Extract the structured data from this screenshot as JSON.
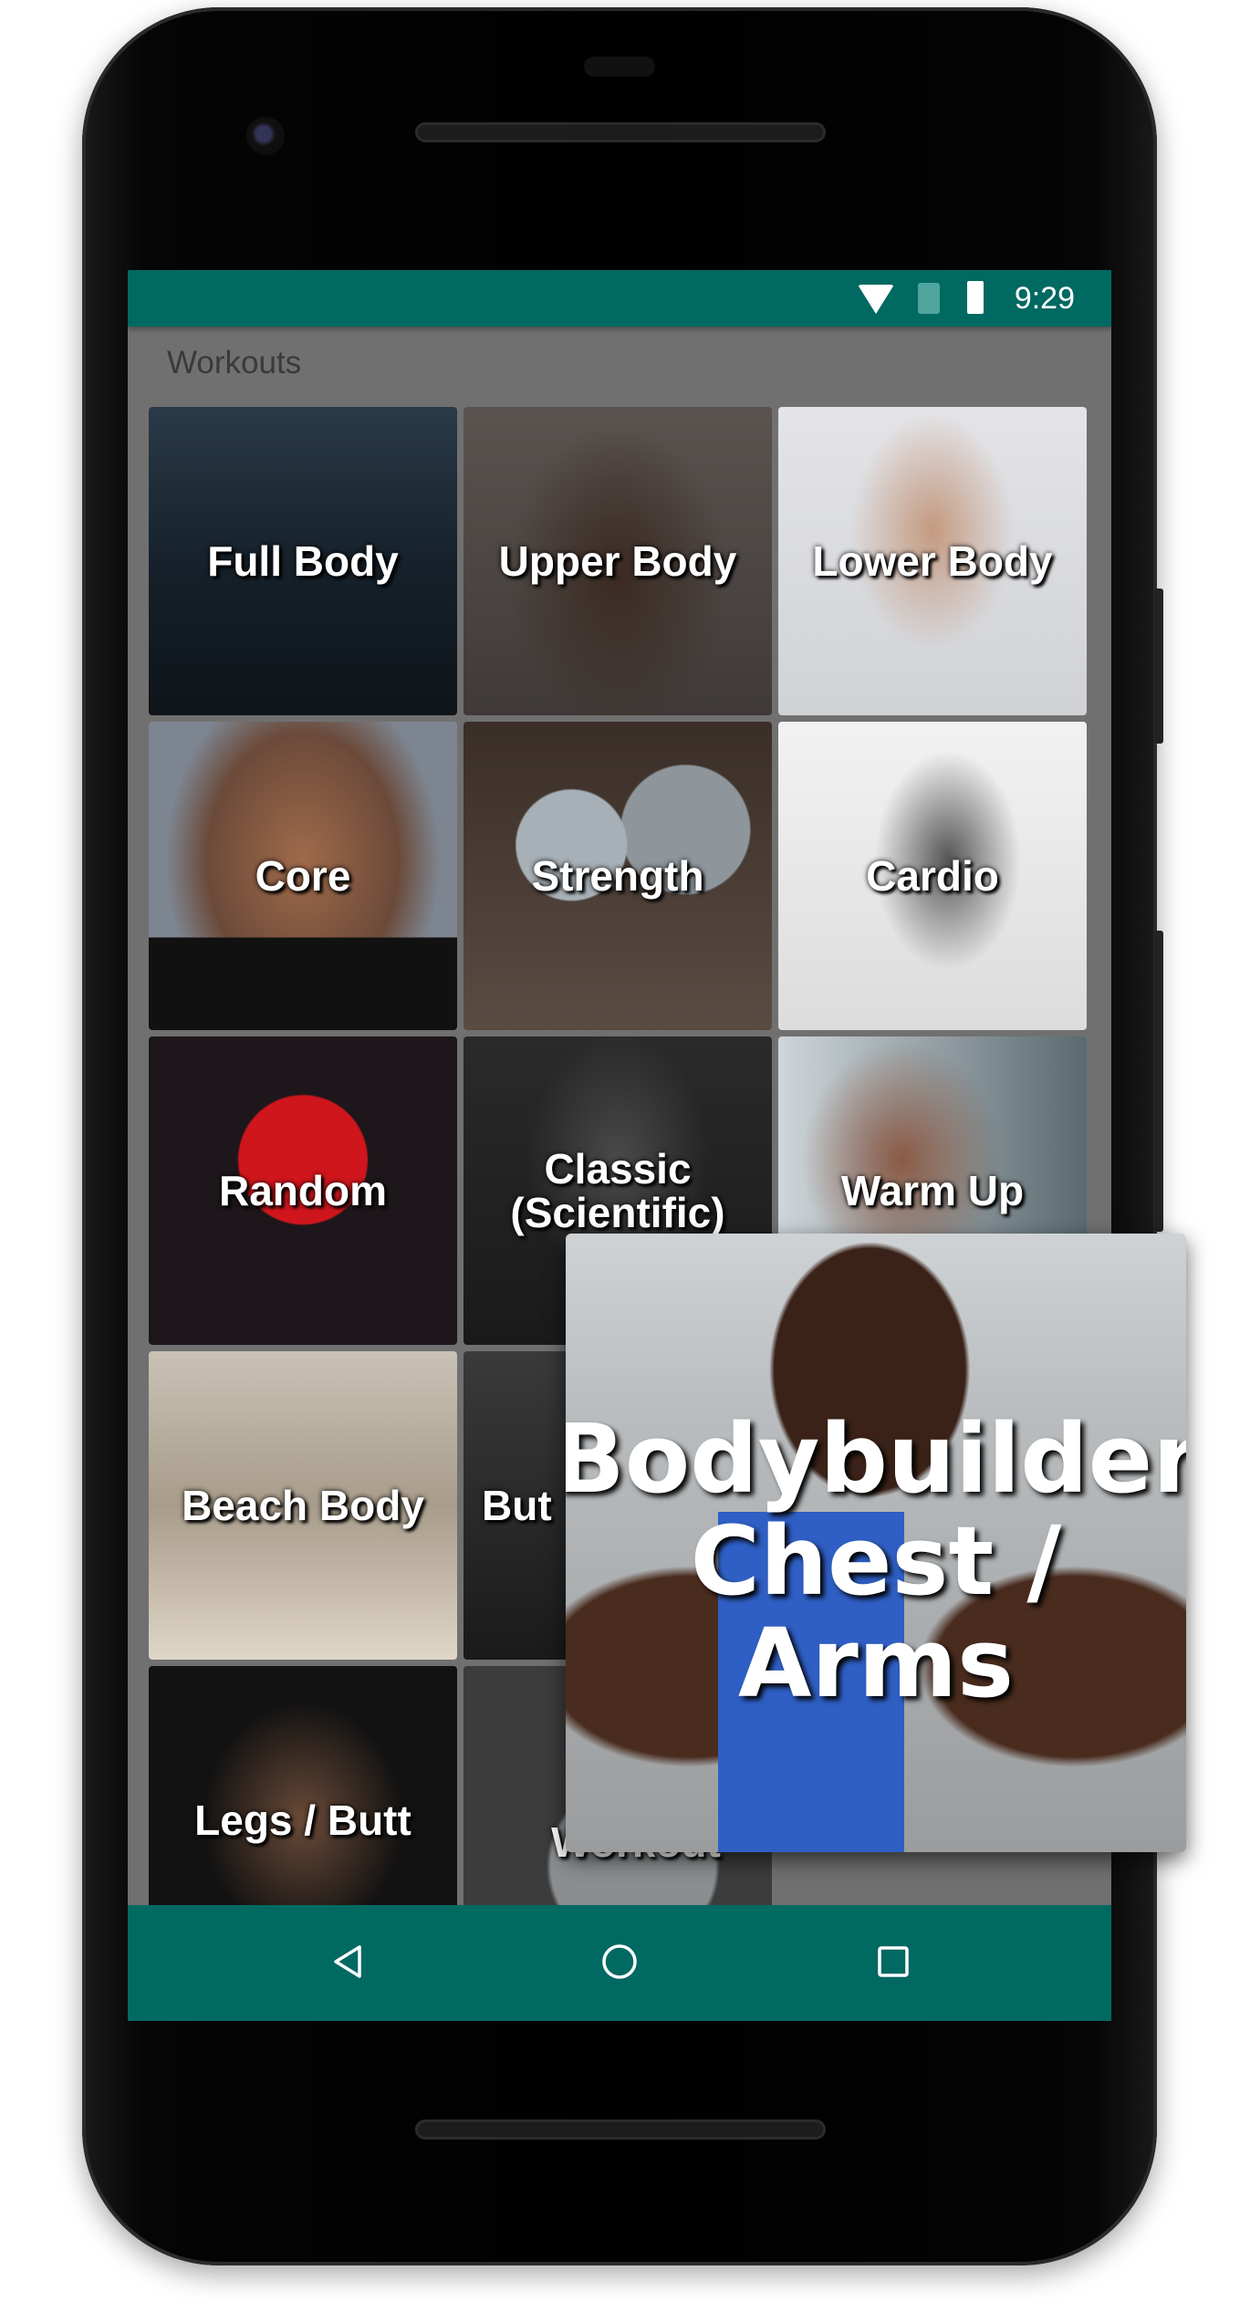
{
  "status_bar": {
    "time": "9:29",
    "icons": [
      "wifi-icon",
      "no-sim-icon",
      "battery-icon"
    ]
  },
  "header": {
    "title": "Workouts"
  },
  "tiles": [
    {
      "label": "Full Body"
    },
    {
      "label": "Upper Body"
    },
    {
      "label": "Lower Body"
    },
    {
      "label": "Core"
    },
    {
      "label": "Strength"
    },
    {
      "label": "Cardio"
    },
    {
      "label": "Random"
    },
    {
      "label": "Classic (Scientific)"
    },
    {
      "label": "Warm Up"
    },
    {
      "label": "Beach Body"
    },
    {
      "label": "But"
    },
    {
      "label": ""
    },
    {
      "label": "Legs / Butt"
    },
    {
      "label": "Create Workout"
    }
  ],
  "featured": {
    "label": "Bodybuilder Chest / Arms"
  },
  "nav_bar": {
    "icons": [
      "back-icon",
      "home-icon",
      "recents-icon"
    ]
  },
  "colors": {
    "primary": "#006962",
    "background": "#707070"
  }
}
